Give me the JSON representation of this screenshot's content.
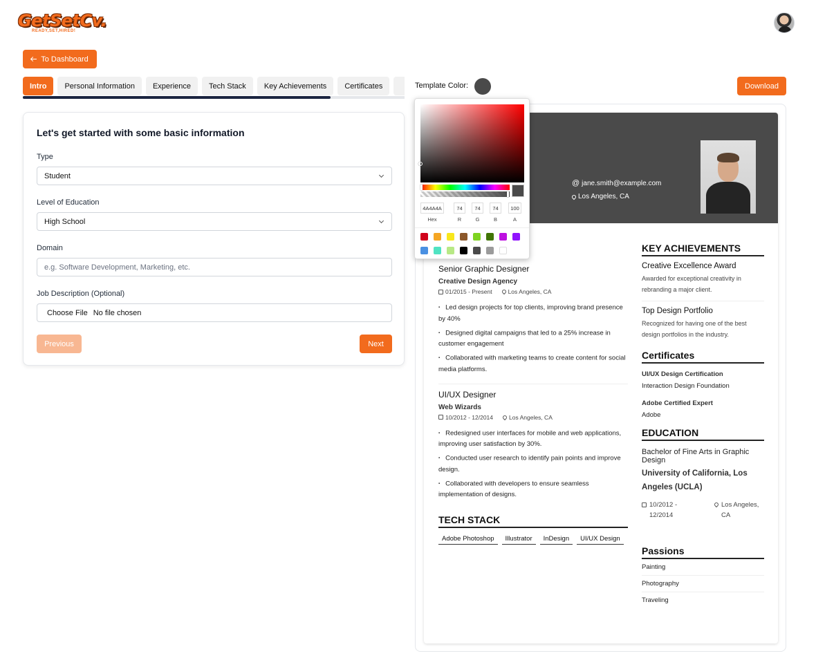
{
  "app": {
    "logo_text": "GetSetCv.",
    "logo_tagline": "READY,SET,HIRED!"
  },
  "nav": {
    "dashboard_label": "To Dashboard"
  },
  "tabs": [
    "Intro",
    "Personal Information",
    "Experience",
    "Tech Stack",
    "Key Achievements",
    "Certificates",
    ""
  ],
  "progress": {
    "fraction": 0.806
  },
  "form": {
    "title": "Let's get started with some basic information",
    "type_label": "Type",
    "type_value": "Student",
    "education_label": "Level of Education",
    "education_value": "High School",
    "domain_label": "Domain",
    "domain_placeholder": "e.g. Software Development, Marketing, etc.",
    "jd_label": "Job Description (Optional)",
    "choose_file": "Choose File",
    "no_file": "No file chosen",
    "previous": "Previous",
    "next": "Next"
  },
  "toolbar": {
    "template_color_label": "Template Color:",
    "template_color": "#4a4a4a",
    "download": "Download"
  },
  "picker": {
    "hex": "4A4A4A",
    "r": "74",
    "g": "74",
    "b": "74",
    "a": "100",
    "labels": {
      "hex": "Hex",
      "r": "R",
      "g": "G",
      "b": "B",
      "a": "A"
    },
    "presets": [
      "#d0021b",
      "#f5a623",
      "#f8e71c",
      "#8b572a",
      "#7ed321",
      "#417505",
      "#bd10e0",
      "#9013fe",
      "#4a90e2",
      "#50e3c2",
      "#b8e986",
      "#000000",
      "#4a4a4a",
      "#9b9b9b",
      "#ffffff"
    ]
  },
  "resume": {
    "email": "jane.smith@example.com",
    "location": "Los Angeles, CA",
    "experience": [
      {
        "title": "Senior Graphic Designer",
        "company": "Creative Design Agency",
        "dates": "01/2015 - Present",
        "location": "Los Angeles, CA",
        "bullets": [
          "Led design projects for top clients, improving brand presence by 40%",
          "Designed digital campaigns that led to a 25% increase in customer engagement",
          "Collaborated with marketing teams to create content for social media platforms."
        ]
      },
      {
        "title": "UI/UX Designer",
        "company": "Web Wizards",
        "dates": "10/2012 - 12/2014",
        "location": "Los Angeles, CA",
        "bullets": [
          "Redesigned user interfaces for mobile and web applications, improving user satisfaction by 30%.",
          "Conducted user research to identify pain points and improve design.",
          "Collaborated with developers to ensure seamless implementation of designs."
        ]
      }
    ],
    "tech_stack_heading": "TECH STACK",
    "tech_stack": [
      "Adobe Photoshop",
      "Illustrator",
      "InDesign",
      "UI/UX Design"
    ],
    "achievements_heading": "KEY ACHIEVEMENTS",
    "achievements": [
      {
        "title": "Creative Excellence Award",
        "desc": "Awarded for exceptional creativity in rebranding a major client."
      },
      {
        "title": "Top Design Portfolio",
        "desc": "Recognized for having one of the best design portfolios in the industry."
      }
    ],
    "certificates_heading": "Certificates",
    "certificates": [
      {
        "title": "UI/UX Design Certification",
        "org": "Interaction Design Foundation"
      },
      {
        "title": "Adobe Certified Expert",
        "org": "Adobe"
      }
    ],
    "education_heading": "EDUCATION",
    "education": {
      "degree": "Bachelor of Fine Arts in Graphic Design",
      "school": "University of California, Los Angeles (UCLA)",
      "dates": "10/2012 - 12/2014",
      "location": "Los Angeles, CA"
    },
    "passions_heading": "Passions",
    "passions": [
      "Painting",
      "Photography",
      "Traveling"
    ]
  }
}
